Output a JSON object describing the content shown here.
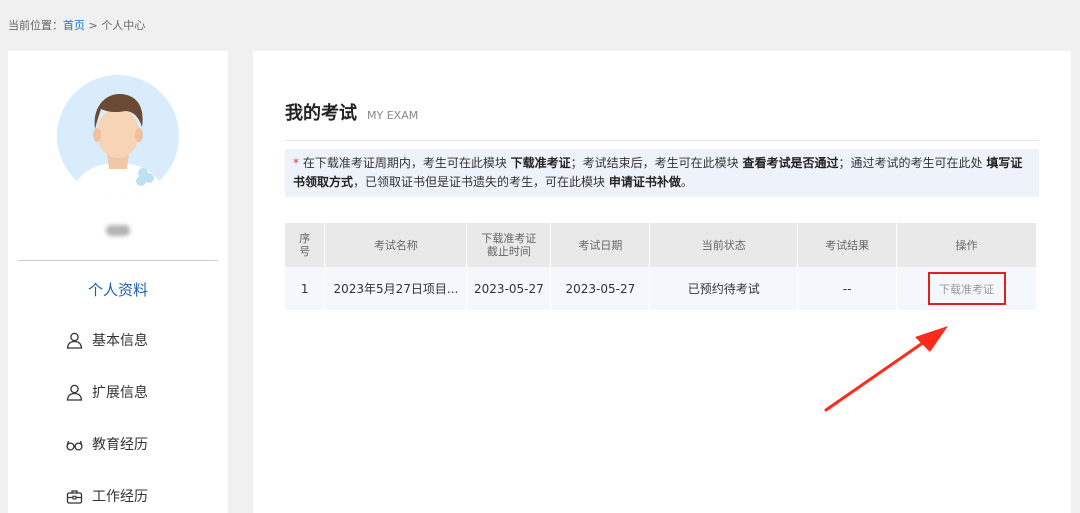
{
  "breadcrumb": {
    "prefix": "当前位置：",
    "home": "首页",
    "separator": " > ",
    "current": "个人中心"
  },
  "sidebar": {
    "section_title": "个人资料",
    "items": [
      {
        "label": "基本信息",
        "icon": "user-icon"
      },
      {
        "label": "扩展信息",
        "icon": "user-icon"
      },
      {
        "label": "教育经历",
        "icon": "glasses-icon"
      },
      {
        "label": "工作经历",
        "icon": "briefcase-icon"
      }
    ]
  },
  "main": {
    "title": "我的考试",
    "title_en": "MY EXAM",
    "notice": {
      "star": "*",
      "p1": " 在下载准考证周期内，考生可在此模块 ",
      "b1": "下载准考证",
      "p2": "；考试结束后，考生可在此模块 ",
      "b2": "查看考试是否通过",
      "p3": "；通过考试的考生可在此处 ",
      "b3": "填写证书领取方式",
      "p4": "，已领取证书但是证书遗失的考生，可在此模块 ",
      "b4": "申请证书补做",
      "p5": "。"
    },
    "table": {
      "headers": {
        "seq_l1": "序",
        "seq_l2": "号",
        "name": "考试名称",
        "deadline_l1": "下载准考证",
        "deadline_l2": "截止时间",
        "date": "考试日期",
        "status": "当前状态",
        "result": "考试结果",
        "action": "操作"
      },
      "rows": [
        {
          "seq": "1",
          "name": "2023年5月27日项目...",
          "deadline": "2023-05-27",
          "date": "2023-05-27",
          "status": "已预约待考试",
          "result": "--",
          "action": "下载准考证"
        }
      ]
    }
  },
  "colors": {
    "link": "#1a6fd3",
    "side_title": "#1a5fb4",
    "highlight_box": "#e02020",
    "arrow": "#ff2a1a"
  }
}
